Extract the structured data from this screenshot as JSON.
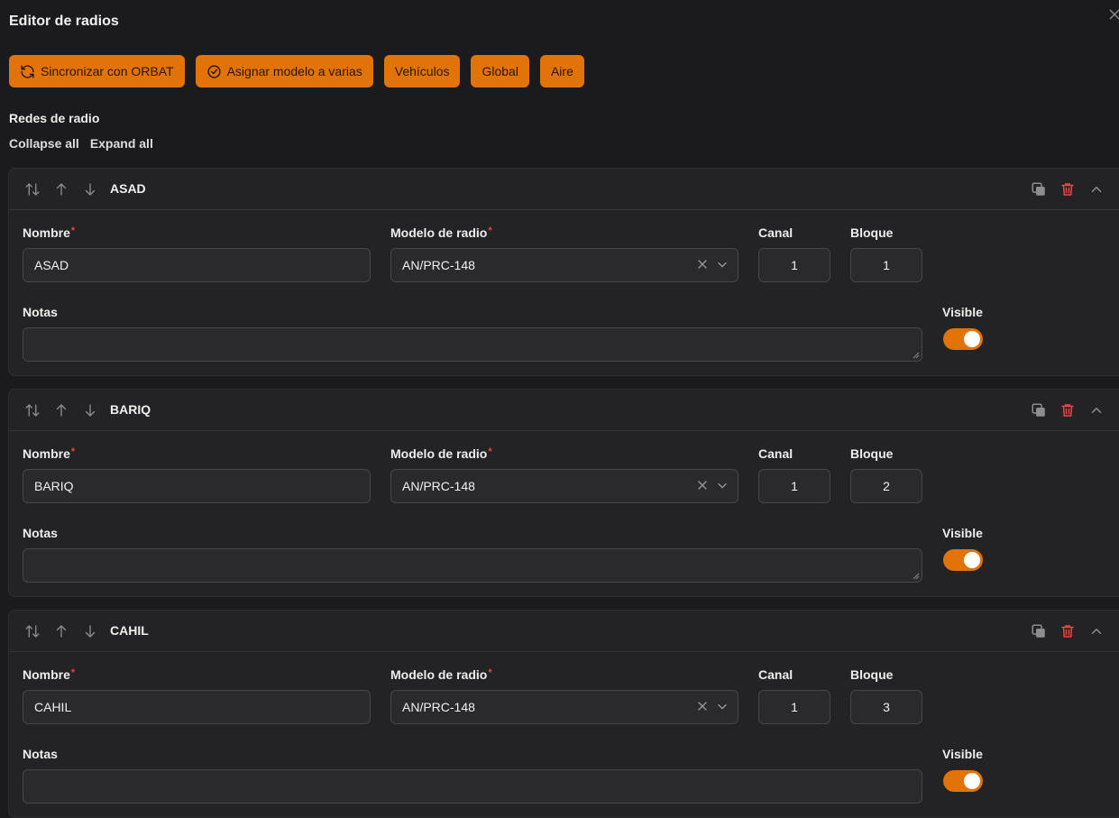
{
  "window": {
    "title": "Editor de radios"
  },
  "toolbar": {
    "sync": "Sincronizar con ORBAT",
    "assign": "Asignar modelo a varias",
    "vehicles": "Vehículos",
    "global": "Global",
    "air": "Aire"
  },
  "section": {
    "title": "Redes de radio",
    "collapse_all": "Collapse all",
    "expand_all": "Expand all"
  },
  "labels": {
    "name": "Nombre",
    "model": "Modelo de radio",
    "channel": "Canal",
    "block": "Bloque",
    "notes": "Notas",
    "visible": "Visible",
    "required_mark": "*"
  },
  "colors": {
    "accent": "#e27308",
    "danger": "#ef4444",
    "background": "#1b1b1d",
    "card": "#232325"
  },
  "nets": [
    {
      "header": "ASAD",
      "name": "ASAD",
      "model": "AN/PRC-148",
      "channel": "1",
      "block": "1",
      "notes": "",
      "visible": true
    },
    {
      "header": "BARIQ",
      "name": "BARIQ",
      "model": "AN/PRC-148",
      "channel": "1",
      "block": "2",
      "notes": "",
      "visible": true
    },
    {
      "header": "CAHIL",
      "name": "CAHIL",
      "model": "AN/PRC-148",
      "channel": "1",
      "block": "3",
      "notes": "",
      "visible": true
    }
  ]
}
